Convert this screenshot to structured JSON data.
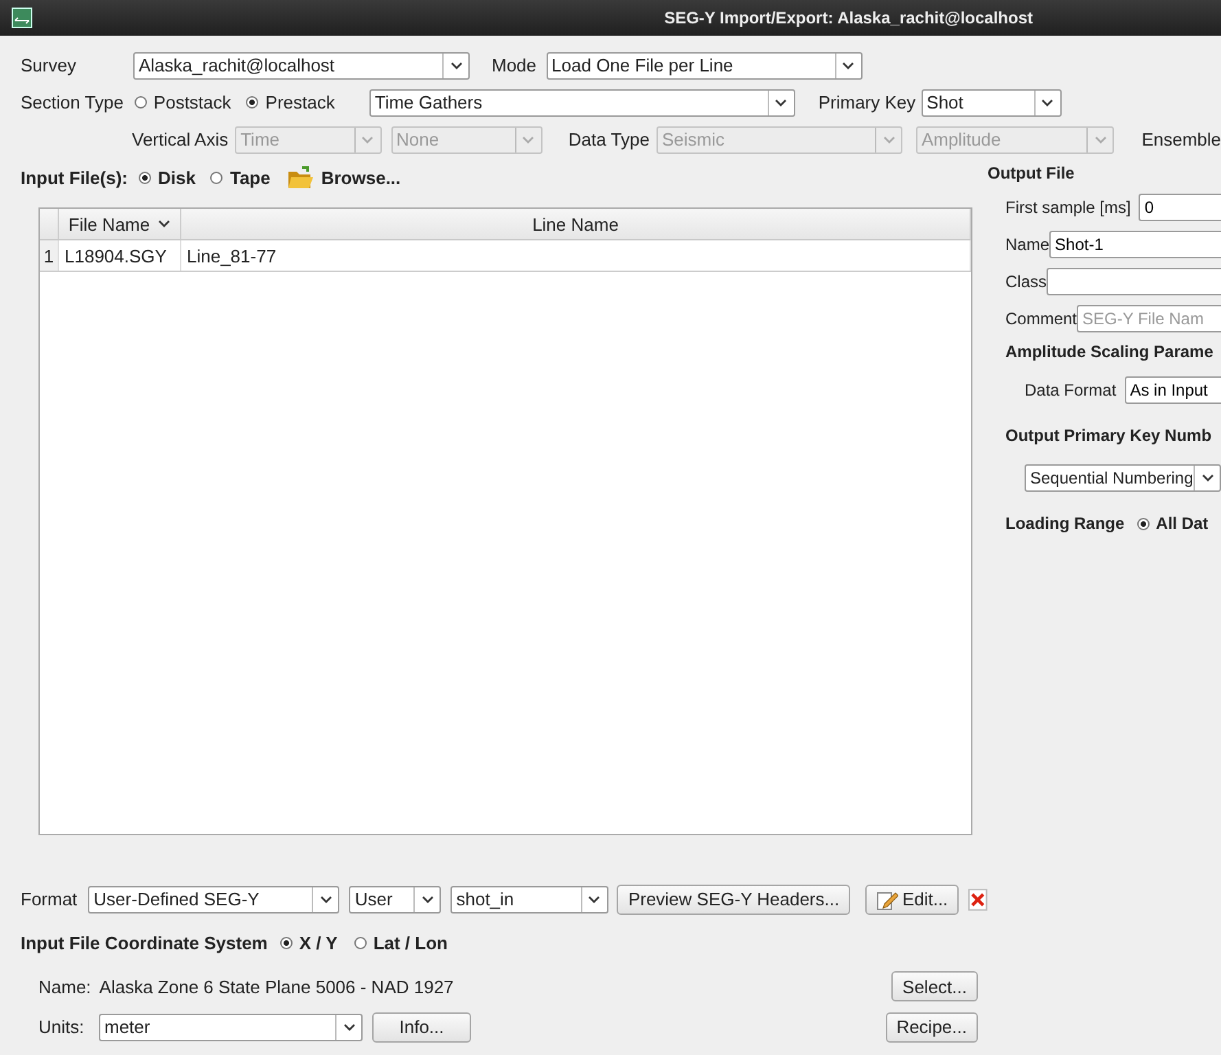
{
  "window": {
    "title": "SEG-Y Import/Export: Alaska_rachit@localhost"
  },
  "survey": {
    "label": "Survey",
    "value": "Alaska_rachit@localhost"
  },
  "mode": {
    "label": "Mode",
    "value": "Load One File per Line"
  },
  "section_type": {
    "label": "Section Type",
    "options": [
      {
        "label": "Poststack",
        "selected": false
      },
      {
        "label": "Prestack",
        "selected": true
      }
    ],
    "gather": "Time Gathers"
  },
  "primary_key": {
    "label": "Primary Key",
    "value": "Shot"
  },
  "vertical_axis": {
    "label": "Vertical Axis",
    "combos": [
      {
        "value": "Time",
        "disabled": true
      },
      {
        "value": "None",
        "disabled": true
      }
    ]
  },
  "data_type": {
    "label": "Data Type",
    "combos": [
      {
        "value": "Seismic",
        "disabled": true
      },
      {
        "value": "Amplitude",
        "disabled": true
      }
    ]
  },
  "ensemble": {
    "label": "Ensemble"
  },
  "input_files": {
    "label": "Input File(s):",
    "options": [
      {
        "label": "Disk",
        "selected": true
      },
      {
        "label": "Tape",
        "selected": false
      }
    ],
    "browse": "Browse..."
  },
  "table": {
    "columns": [
      "File Name",
      "Line Name"
    ],
    "rows": [
      {
        "index": "1",
        "cells": [
          "L18904.SGY",
          "Line_81-77"
        ]
      }
    ]
  },
  "format": {
    "label": "Format",
    "combos": [
      {
        "value": "User-Defined SEG-Y",
        "disabled": false
      },
      {
        "value": "User",
        "disabled": false
      },
      {
        "value": "shot_in",
        "disabled": false
      }
    ],
    "preview": "Preview SEG-Y Headers...",
    "edit": "Edit..."
  },
  "coordinate_system": {
    "label": "Input File Coordinate System",
    "options": [
      {
        "label": "X / Y",
        "selected": true
      },
      {
        "label": "Lat / Lon",
        "selected": false
      }
    ],
    "name_label": "Name:",
    "name_value": "Alaska Zone 6 State Plane 5006 - NAD 1927",
    "select": "Select...",
    "units_label": "Units:",
    "units": "meter",
    "info": "Info...",
    "recipe": "Recipe..."
  },
  "output_file": {
    "title": "Output File",
    "first_sample": {
      "label": "First sample [ms]",
      "value": "0"
    },
    "name": {
      "label": "Name",
      "value": "Shot-1"
    },
    "class": {
      "label": "Class"
    },
    "comment": {
      "label": "Comment",
      "placeholder": "SEG-Y File Nam"
    },
    "amplitude_title": "Amplitude Scaling Parame",
    "data_format": {
      "label": "Data Format",
      "value": "As in Input"
    },
    "primary_key_title": "Output Primary Key Numb",
    "numbering": "Sequential Numbering",
    "loading_range": {
      "label": "Loading Range",
      "options": [
        {
          "label": "All Dat",
          "selected": true
        }
      ]
    }
  }
}
